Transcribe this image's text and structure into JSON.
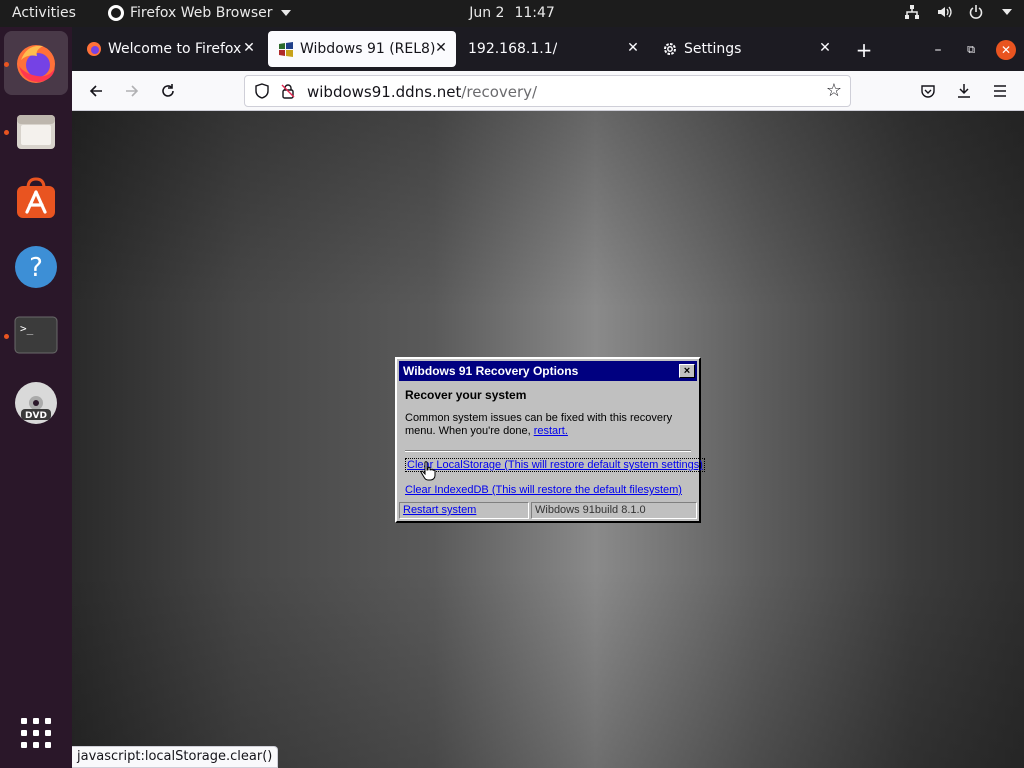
{
  "topbar": {
    "activities": "Activities",
    "app_name": "Firefox Web Browser",
    "date": "Jun 2",
    "time": "11:47"
  },
  "dock": {
    "items": [
      {
        "name": "firefox",
        "active": true,
        "running": true
      },
      {
        "name": "files",
        "active": false,
        "running": true
      },
      {
        "name": "ubuntu-software",
        "active": false,
        "running": false
      },
      {
        "name": "help",
        "active": false,
        "running": false
      },
      {
        "name": "terminal",
        "active": false,
        "running": true
      },
      {
        "name": "dvd",
        "active": false,
        "running": false
      }
    ],
    "show_apps_icon": "grid-icon"
  },
  "browser": {
    "tabs": [
      {
        "title": "Welcome to Firefox",
        "favicon": "firefox-icon",
        "selected": false
      },
      {
        "title": "Wibdows 91 (REL8)",
        "favicon": "wibdows-icon",
        "selected": true
      },
      {
        "title": "192.168.1.1/",
        "favicon": "",
        "selected": false
      },
      {
        "title": "Settings",
        "favicon": "gear-icon",
        "selected": false
      }
    ],
    "new_tab": "+",
    "url": {
      "host": "wibdows91.ddns.net",
      "path": "/recovery/"
    },
    "status_link": "javascript:localStorage.clear()"
  },
  "dialog": {
    "title": "Wibdows 91 Recovery Options",
    "close": "×",
    "heading": "Recover your system",
    "description": "Common system issues can be fixed with this recovery menu. When you're done,",
    "restart_link": "restart.",
    "option_localstorage": "Clear LocalStorage (This will restore default system settings)",
    "option_indexeddb": "Clear IndexedDB (This will restore the default filesystem)",
    "restart_system": "Restart system",
    "build": "Wibdows 91build 8.1.0"
  },
  "colors": {
    "ubuntu_orange": "#e95420",
    "dock_bg": "#2a1729",
    "win_titlebar": "#000080",
    "win_face": "#c0c0c0",
    "link": "#0000ee"
  }
}
